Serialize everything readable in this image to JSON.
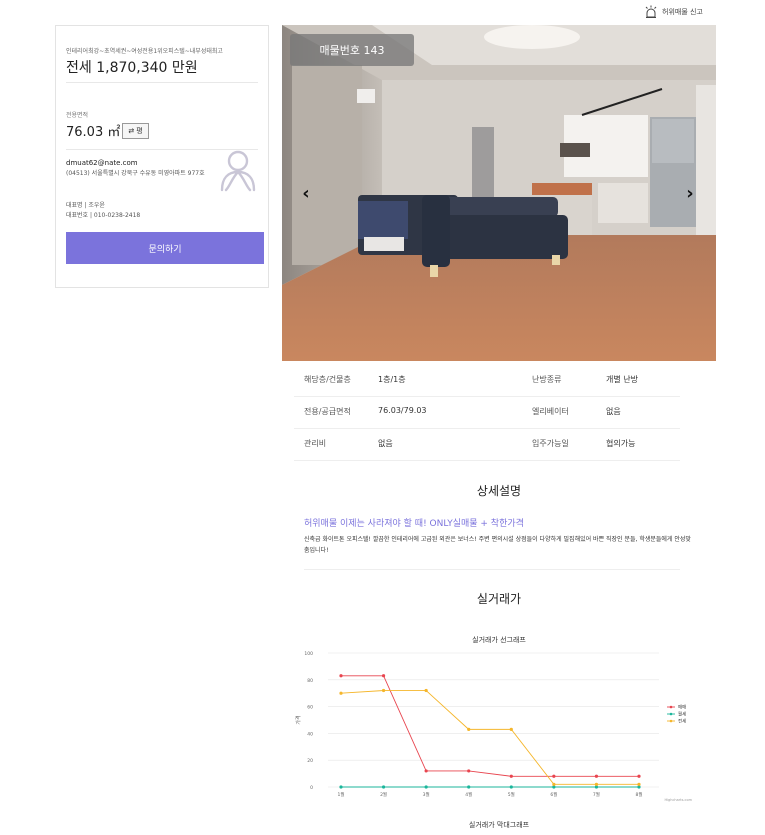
{
  "report": {
    "label": "허위매물 신고",
    "icon": "siren-icon"
  },
  "agent": {
    "breadcrumb": "인테리어최강~초역세권~여성전용1위오피스텔~내부성태최고",
    "price": "전세 1,870,340 만원",
    "area_label": "전용면적",
    "area_value": "76.03 ㎡",
    "unit_toggle": "평",
    "email": "dmuat62@nate.com",
    "address": "(04513) 서울특별시 강북구 수유동 미영아파트 977호",
    "ceo": "대표명 | 조우윤",
    "phone": "대표번호 | 010-0238-2418",
    "inquiry_label": "문의하기",
    "accent": "#7b73dc"
  },
  "photo": {
    "badge": "매물번호 143",
    "prev_label": "‹",
    "next_label": "›"
  },
  "specs": [
    {
      "k1": "해당층/건물층",
      "v1": "1층/1층",
      "k2": "난방종류",
      "v2": "개별 난방"
    },
    {
      "k1": "전용/공급면적",
      "v1": "76.03/79.03",
      "k2": "엘리베이터",
      "v2": "없음"
    },
    {
      "k1": "관리비",
      "v1": "없음",
      "k2": "입주가능일",
      "v2": "협의가능"
    }
  ],
  "detail": {
    "title": "상세설명",
    "headline": "허위매물 이제는 사라져야 할 때! ONLY실매물 + 착한가격",
    "body": "신축급 화이트톤 오피스텔! 깔끔한 인테리어에 고급된 외관은 보너스! 주변 편의시설 상점들이 다양하게 밀집해있어 바쁜 직장인 분들, 학생분들에게 안성맞춤입니다!"
  },
  "trade": {
    "title": "실거래가",
    "bottom_caption": "실거래가 막대그래프"
  },
  "chart_data": {
    "type": "line",
    "title": "실거래가 선그래프",
    "ylabel": "가격",
    "xlabel": "",
    "ylim": [
      0,
      100
    ],
    "yticks": [
      0,
      20,
      40,
      60,
      80,
      100
    ],
    "categories": [
      "1월",
      "2월",
      "3월",
      "4월",
      "5월",
      "6월",
      "7월",
      "8월"
    ],
    "series": [
      {
        "name": "매매",
        "color": "#e8454f",
        "values": [
          83,
          83,
          12,
          12,
          8,
          8,
          8,
          8
        ]
      },
      {
        "name": "월세",
        "color": "#1bb69b",
        "values": [
          0,
          0,
          0,
          0,
          0,
          0,
          0,
          0
        ]
      },
      {
        "name": "전세",
        "color": "#f5b62b",
        "values": [
          70,
          72,
          72,
          43,
          43,
          2,
          2,
          2
        ]
      }
    ],
    "legend": "right",
    "grid": true,
    "credit": "Highcharts.com"
  }
}
